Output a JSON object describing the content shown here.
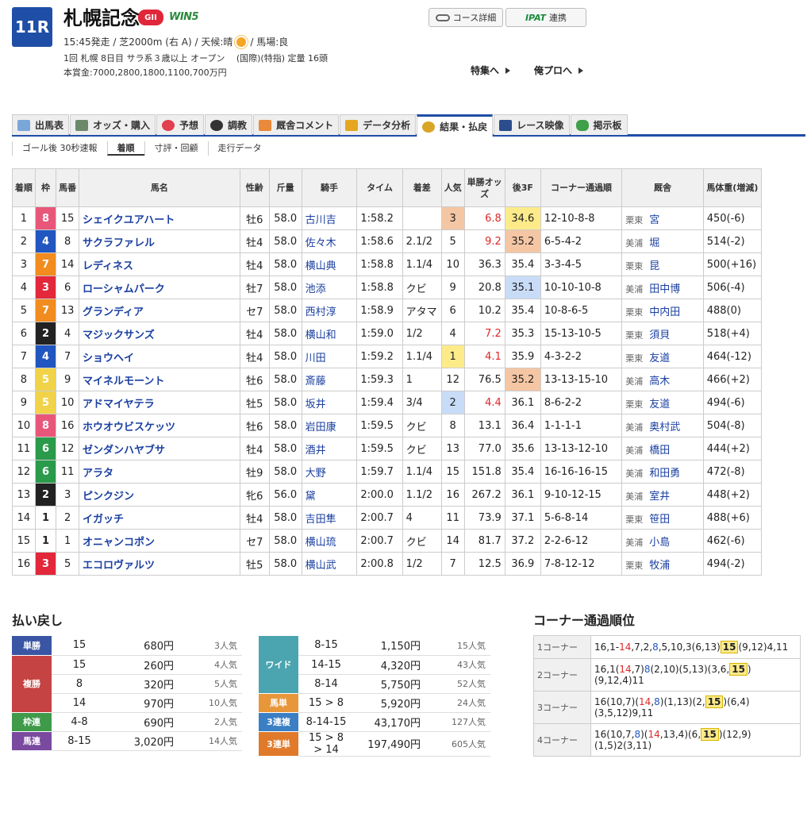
{
  "header": {
    "race_no": "11R",
    "race_name": "札幌記念",
    "grade": "GII",
    "win5": "WIN5",
    "sub1_a": "15:45発走 / 芝2000m (右 A) / 天候:晴",
    "sub1_b": "/ 馬場:良",
    "sub2": "1回 札幌 8日目 サラ系３歳以上 オープン 　(国際)(特指) 定量 16頭",
    "sub3": "本賞金:7000,2800,1800,1100,700万円",
    "course_btn": "コース詳細",
    "ipat_logo": "IPAT",
    "ipat_btn": "連携",
    "link_tokushu": "特集へ",
    "link_oreplo": "俺プロへ"
  },
  "tabs": [
    "出馬表",
    "オッズ・購入",
    "予想",
    "調教",
    "厩舎コメント",
    "データ分析",
    "結果・払戻",
    "レース映像",
    "掲示板"
  ],
  "subtabs": [
    "ゴール後 30秒速報",
    "着順",
    "寸評・回顧",
    "走行データ"
  ],
  "table_headers": [
    "着順",
    "枠",
    "馬番",
    "馬名",
    "性齢",
    "斤量",
    "騎手",
    "タイム",
    "着差",
    "人気",
    "単勝オッズ",
    "後3F",
    "コーナー通過順",
    "厩舎",
    "馬体重(増減)"
  ],
  "rows": [
    {
      "pos": "1",
      "waku": "8",
      "num": "15",
      "name": "シェイクユアハート",
      "sex": "牡6",
      "wt": "58.0",
      "jockey": "古川吉",
      "time": "1:58.2",
      "margin": "",
      "pop": "3",
      "odds": "6.8",
      "f3": "34.6",
      "corner": "12-10-8-8",
      "reg": "栗東",
      "trainer": "宮",
      "bw": "450(-6)"
    },
    {
      "pos": "2",
      "waku": "4",
      "num": "8",
      "name": "サクラファレル",
      "sex": "牡4",
      "wt": "58.0",
      "jockey": "佐々木",
      "time": "1:58.6",
      "margin": "2.1/2",
      "pop": "5",
      "odds": "9.2",
      "f3": "35.2",
      "corner": "6-5-4-2",
      "reg": "美浦",
      "trainer": "堀",
      "bw": "514(-2)"
    },
    {
      "pos": "3",
      "waku": "7",
      "num": "14",
      "name": "レディネス",
      "sex": "牡4",
      "wt": "58.0",
      "jockey": "横山典",
      "time": "1:58.8",
      "margin": "1.1/4",
      "pop": "10",
      "odds": "36.3",
      "f3": "35.4",
      "corner": "3-3-4-5",
      "reg": "栗東",
      "trainer": "昆",
      "bw": "500(+16)"
    },
    {
      "pos": "4",
      "waku": "3",
      "num": "6",
      "name": "ローシャムパーク",
      "sex": "牡7",
      "wt": "58.0",
      "jockey": "池添",
      "time": "1:58.8",
      "margin": "クビ",
      "pop": "9",
      "odds": "20.8",
      "f3": "35.1",
      "corner": "10-10-10-8",
      "reg": "美浦",
      "trainer": "田中博",
      "bw": "506(-4)"
    },
    {
      "pos": "5",
      "waku": "7",
      "num": "13",
      "name": "グランディア",
      "sex": "セ7",
      "wt": "58.0",
      "jockey": "西村淳",
      "time": "1:58.9",
      "margin": "アタマ",
      "pop": "6",
      "odds": "10.2",
      "f3": "35.4",
      "corner": "10-8-6-5",
      "reg": "栗東",
      "trainer": "中内田",
      "bw": "488(0)"
    },
    {
      "pos": "6",
      "waku": "2",
      "num": "4",
      "name": "マジックサンズ",
      "sex": "牡4",
      "wt": "58.0",
      "jockey": "横山和",
      "time": "1:59.0",
      "margin": "1/2",
      "pop": "4",
      "odds": "7.2",
      "f3": "35.3",
      "corner": "15-13-10-5",
      "reg": "栗東",
      "trainer": "須貝",
      "bw": "518(+4)"
    },
    {
      "pos": "7",
      "waku": "4",
      "num": "7",
      "name": "ショウヘイ",
      "sex": "牡4",
      "wt": "58.0",
      "jockey": "川田",
      "time": "1:59.2",
      "margin": "1.1/4",
      "pop": "1",
      "odds": "4.1",
      "f3": "35.9",
      "corner": "4-3-2-2",
      "reg": "栗東",
      "trainer": "友道",
      "bw": "464(-12)"
    },
    {
      "pos": "8",
      "waku": "5",
      "num": "9",
      "name": "マイネルモーント",
      "sex": "牡6",
      "wt": "58.0",
      "jockey": "斎藤",
      "time": "1:59.3",
      "margin": "1",
      "pop": "12",
      "odds": "76.5",
      "f3": "35.2",
      "corner": "13-13-15-10",
      "reg": "美浦",
      "trainer": "高木",
      "bw": "466(+2)"
    },
    {
      "pos": "9",
      "waku": "5",
      "num": "10",
      "name": "アドマイヤテラ",
      "sex": "牡5",
      "wt": "58.0",
      "jockey": "坂井",
      "time": "1:59.4",
      "margin": "3/4",
      "pop": "2",
      "odds": "4.4",
      "f3": "36.1",
      "corner": "8-6-2-2",
      "reg": "栗東",
      "trainer": "友道",
      "bw": "494(-6)"
    },
    {
      "pos": "10",
      "waku": "8",
      "num": "16",
      "name": "ホウオウビスケッツ",
      "sex": "牡6",
      "wt": "58.0",
      "jockey": "岩田康",
      "time": "1:59.5",
      "margin": "クビ",
      "pop": "8",
      "odds": "13.1",
      "f3": "36.4",
      "corner": "1-1-1-1",
      "reg": "美浦",
      "trainer": "奥村武",
      "bw": "504(-8)"
    },
    {
      "pos": "11",
      "waku": "6",
      "num": "12",
      "name": "ゼンダンハヤブサ",
      "sex": "牡4",
      "wt": "58.0",
      "jockey": "酒井",
      "time": "1:59.5",
      "margin": "クビ",
      "pop": "13",
      "odds": "77.0",
      "f3": "35.6",
      "corner": "13-13-12-10",
      "reg": "美浦",
      "trainer": "橋田",
      "bw": "444(+2)"
    },
    {
      "pos": "12",
      "waku": "6",
      "num": "11",
      "name": "アラタ",
      "sex": "牡9",
      "wt": "58.0",
      "jockey": "大野",
      "time": "1:59.7",
      "margin": "1.1/4",
      "pop": "15",
      "odds": "151.8",
      "f3": "35.4",
      "corner": "16-16-16-15",
      "reg": "美浦",
      "trainer": "和田勇",
      "bw": "472(-8)"
    },
    {
      "pos": "13",
      "waku": "2",
      "num": "3",
      "name": "ピンクジン",
      "sex": "牝6",
      "wt": "56.0",
      "jockey": "黛",
      "time": "2:00.0",
      "margin": "1.1/2",
      "pop": "16",
      "odds": "267.2",
      "f3": "36.1",
      "corner": "9-10-12-15",
      "reg": "美浦",
      "trainer": "室井",
      "bw": "448(+2)"
    },
    {
      "pos": "14",
      "waku": "1",
      "num": "2",
      "name": "イガッチ",
      "sex": "牡4",
      "wt": "58.0",
      "jockey": "吉田隼",
      "time": "2:00.7",
      "margin": "4",
      "pop": "11",
      "odds": "73.9",
      "f3": "37.1",
      "corner": "5-6-8-14",
      "reg": "栗東",
      "trainer": "笹田",
      "bw": "488(+6)"
    },
    {
      "pos": "15",
      "waku": "1",
      "num": "1",
      "name": "オニャンコポン",
      "sex": "セ7",
      "wt": "58.0",
      "jockey": "横山琉",
      "time": "2:00.7",
      "margin": "クビ",
      "pop": "14",
      "odds": "81.7",
      "f3": "37.2",
      "corner": "2-2-6-12",
      "reg": "美浦",
      "trainer": "小島",
      "bw": "462(-6)"
    },
    {
      "pos": "16",
      "waku": "3",
      "num": "5",
      "name": "エコロヴァルツ",
      "sex": "牡5",
      "wt": "58.0",
      "jockey": "横山武",
      "time": "2:00.8",
      "margin": "1/2",
      "pop": "7",
      "odds": "12.5",
      "f3": "36.9",
      "corner": "7-8-12-12",
      "reg": "栗東",
      "trainer": "牧浦",
      "bw": "494(-2)"
    }
  ],
  "payout_title": "払い戻し",
  "payout_left": [
    {
      "label": "単勝",
      "color": "#3a55a4",
      "rows": [
        {
          "combo": "15",
          "amount": "680円",
          "pop": "3人気"
        }
      ]
    },
    {
      "label": "複勝",
      "color": "#c64343",
      "rows": [
        {
          "combo": "15",
          "amount": "260円",
          "pop": "4人気"
        },
        {
          "combo": "8",
          "amount": "320円",
          "pop": "5人気"
        },
        {
          "combo": "14",
          "amount": "970円",
          "pop": "10人気"
        }
      ]
    },
    {
      "label": "枠連",
      "color": "#3f9a4a",
      "rows": [
        {
          "combo": "4-8",
          "amount": "690円",
          "pop": "2人気"
        }
      ]
    },
    {
      "label": "馬連",
      "color": "#7a4aa0",
      "rows": [
        {
          "combo": "8-15",
          "amount": "3,020円",
          "pop": "14人気"
        }
      ]
    }
  ],
  "payout_right": [
    {
      "label": "ワイド",
      "color": "#4aa5b0",
      "rows": [
        {
          "combo": "8-15",
          "amount": "1,150円",
          "pop": "15人気"
        },
        {
          "combo": "14-15",
          "amount": "4,320円",
          "pop": "43人気"
        },
        {
          "combo": "8-14",
          "amount": "5,750円",
          "pop": "52人気"
        }
      ]
    },
    {
      "label": "馬単",
      "color": "#e8963a",
      "rows": [
        {
          "combo": "15 > 8",
          "amount": "5,920円",
          "pop": "24人気"
        }
      ]
    },
    {
      "label": "3連複",
      "color": "#3a7fc4",
      "rows": [
        {
          "combo": "8-14-15",
          "amount": "43,170円",
          "pop": "127人気"
        }
      ]
    },
    {
      "label": "3連単",
      "color": "#e07a2a",
      "rows": [
        {
          "combo": "15 > 8 > 14",
          "amount": "197,490円",
          "pop": "605人気"
        }
      ]
    }
  ],
  "corner_title": "コーナー通過順位",
  "corners": [
    {
      "label": "1コーナー",
      "parts": [
        [
          "16,1-",
          ""
        ],
        [
          "14",
          "r"
        ],
        [
          ",7,2,",
          ""
        ],
        [
          "8",
          "b"
        ],
        [
          ",5,10,3(6,13)",
          ""
        ],
        [
          "15",
          "h"
        ],
        [
          "(9,12)4,11",
          ""
        ]
      ]
    },
    {
      "label": "2コーナー",
      "parts": [
        [
          "16,1(",
          ""
        ],
        [
          "14",
          "r"
        ],
        [
          ",7)",
          ""
        ],
        [
          "8",
          "b"
        ],
        [
          "(2,10)(5,13)(3,6,",
          ""
        ],
        [
          "15",
          "h"
        ],
        [
          ")(9,12,4)11",
          ""
        ]
      ]
    },
    {
      "label": "3コーナー",
      "parts": [
        [
          "16(10,7)(",
          ""
        ],
        [
          "14",
          "r"
        ],
        [
          ",",
          ""
        ],
        [
          "8",
          "b"
        ],
        [
          ")(1,13)(2,",
          ""
        ],
        [
          "15",
          "h"
        ],
        [
          ")(6,4)(3,5,12)9,11",
          ""
        ]
      ]
    },
    {
      "label": "4コーナー",
      "parts": [
        [
          "16(10,7,",
          ""
        ],
        [
          "8",
          "b"
        ],
        [
          ")(",
          ""
        ],
        [
          "14",
          "r"
        ],
        [
          ",13,4)(6,",
          ""
        ],
        [
          "15",
          "h"
        ],
        [
          ")(12,9)(1,5)2(3,11)",
          ""
        ]
      ]
    }
  ]
}
